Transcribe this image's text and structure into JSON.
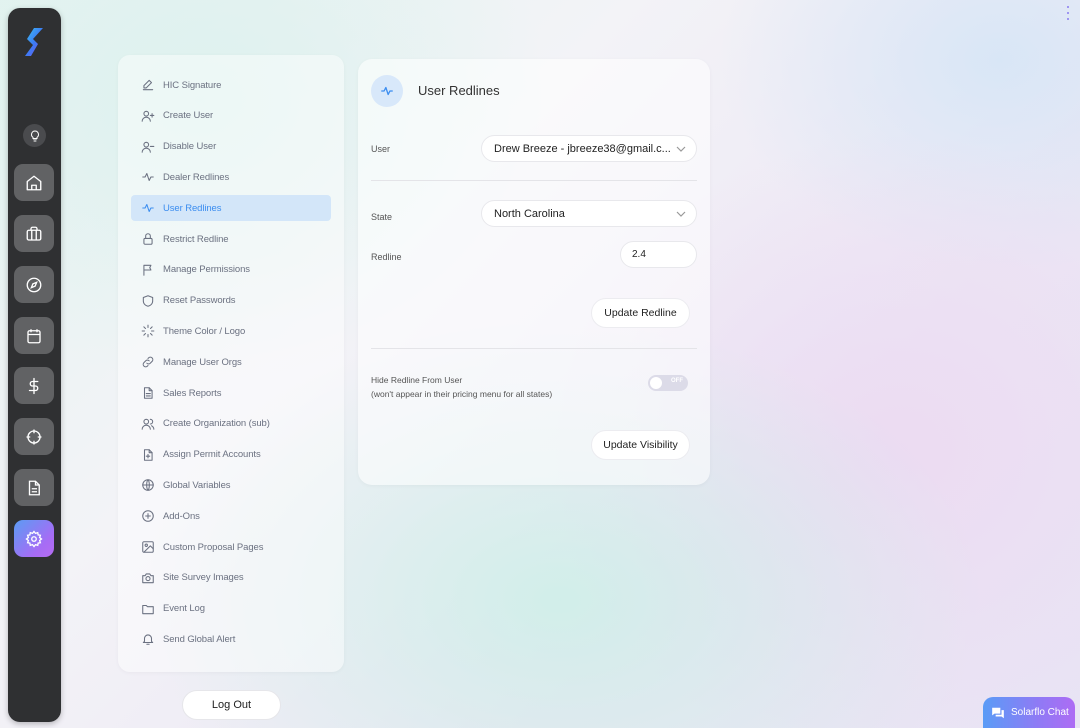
{
  "rail": {
    "items": [
      {
        "name": "home",
        "icon": "home-icon",
        "active": false
      },
      {
        "name": "briefcase",
        "icon": "briefcase-icon",
        "active": false
      },
      {
        "name": "compass",
        "icon": "compass-icon",
        "active": false
      },
      {
        "name": "calendar",
        "icon": "calendar-icon",
        "active": false
      },
      {
        "name": "dollar",
        "icon": "dollar-icon",
        "active": false
      },
      {
        "name": "crosshair",
        "icon": "crosshair-icon",
        "active": false
      },
      {
        "name": "document",
        "icon": "document-icon",
        "active": false
      },
      {
        "name": "settings",
        "icon": "gear-icon",
        "active": true
      }
    ],
    "accent_gradient": [
      "#5b9cf4",
      "#b56cf2"
    ]
  },
  "menu": {
    "items": [
      {
        "label": "HIC Signature",
        "icon": "pen-icon"
      },
      {
        "label": "Create User",
        "icon": "user-plus-icon"
      },
      {
        "label": "Disable User",
        "icon": "user-minus-icon"
      },
      {
        "label": "Dealer Redlines",
        "icon": "activity-icon"
      },
      {
        "label": "User Redlines",
        "icon": "activity-icon",
        "active": true
      },
      {
        "label": "Restrict Redline",
        "icon": "lock-icon"
      },
      {
        "label": "Manage Permissions",
        "icon": "flag-icon"
      },
      {
        "label": "Reset Passwords",
        "icon": "shield-icon"
      },
      {
        "label": "Theme Color / Logo",
        "icon": "loader-icon"
      },
      {
        "label": "Manage User Orgs",
        "icon": "link-icon"
      },
      {
        "label": "Sales Reports",
        "icon": "file-text-icon"
      },
      {
        "label": "Create Organization (sub)",
        "icon": "users-icon"
      },
      {
        "label": "Assign Permit Accounts",
        "icon": "file-plus-icon"
      },
      {
        "label": "Global Variables",
        "icon": "globe-icon"
      },
      {
        "label": "Add-Ons",
        "icon": "plus-circle-icon"
      },
      {
        "label": "Custom Proposal Pages",
        "icon": "image-icon"
      },
      {
        "label": "Site Survey Images",
        "icon": "camera-icon"
      },
      {
        "label": "Event Log",
        "icon": "folder-icon"
      },
      {
        "label": "Send Global Alert",
        "icon": "bell-icon"
      }
    ],
    "active_color": "#3b8df0",
    "logout_label": "Log Out"
  },
  "card": {
    "title": "User Redlines",
    "user_label": "User",
    "user_value": "Drew Breeze - jbreeze38@gmail.c...",
    "state_label": "State",
    "state_value": "North Carolina",
    "redline_label": "Redline",
    "redline_value": "2.4",
    "update_redline_label": "Update Redline",
    "hide_label": "Hide Redline From User",
    "hide_sublabel": "(won't appear in their pricing menu for all states)",
    "toggle_state": "OFF",
    "update_visibility_label": "Update Visibility"
  },
  "chat": {
    "label": "Solarflo Chat"
  }
}
